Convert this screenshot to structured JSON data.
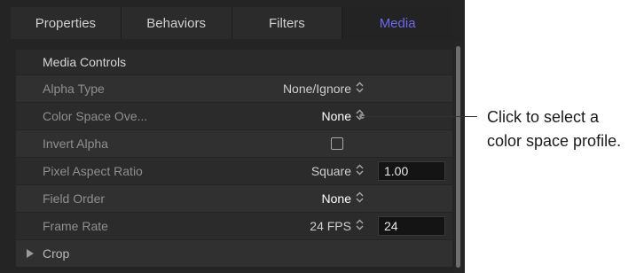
{
  "tabs": [
    {
      "label": "Properties"
    },
    {
      "label": "Behaviors"
    },
    {
      "label": "Filters"
    },
    {
      "label": "Media"
    }
  ],
  "active_tab": "Media",
  "section": {
    "title": "Media Controls"
  },
  "rows": {
    "alpha_type": {
      "label": "Alpha Type",
      "value": "None/Ignore"
    },
    "color_space": {
      "label": "Color Space Ove...",
      "value": "None"
    },
    "invert_alpha": {
      "label": "Invert Alpha",
      "checked": false
    },
    "pixel_aspect": {
      "label": "Pixel Aspect Ratio",
      "value": "Square",
      "field": "1.00"
    },
    "field_order": {
      "label": "Field Order",
      "value": "None"
    },
    "frame_rate": {
      "label": "Frame Rate",
      "value": "24 FPS",
      "field": "24"
    },
    "crop": {
      "label": "Crop"
    }
  },
  "stepper_glyph": "⌃⌄",
  "callout": {
    "line1": "Click to select a",
    "line2": "color space profile."
  },
  "colors": {
    "active_tab": "#6c68f0",
    "panel_bg": "#242424"
  }
}
